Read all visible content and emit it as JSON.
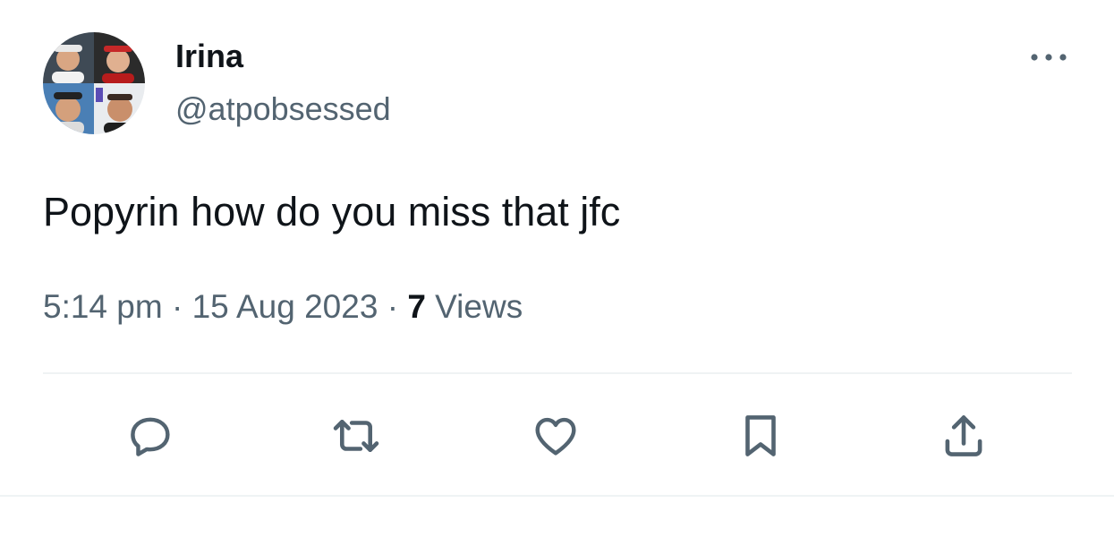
{
  "tweet": {
    "author": {
      "display_name": "Irina",
      "handle": "@atpobsessed",
      "avatar": "collage-avatar"
    },
    "text": "Popyrin how do you miss that jfc",
    "meta": {
      "time": "5:14 pm",
      "separator1": " · ",
      "date": "15 Aug 2023",
      "separator2": " · ",
      "views_count": "7",
      "views_label": " Views"
    },
    "actions": [
      {
        "icon": "reply-icon"
      },
      {
        "icon": "retweet-icon"
      },
      {
        "icon": "like-icon"
      },
      {
        "icon": "bookmark-icon"
      },
      {
        "icon": "share-icon"
      }
    ],
    "more_icon": "more-options-icon",
    "colors": {
      "primary_text": "#0f1419",
      "secondary_text": "#536471",
      "divider": "#eff3f4"
    }
  }
}
